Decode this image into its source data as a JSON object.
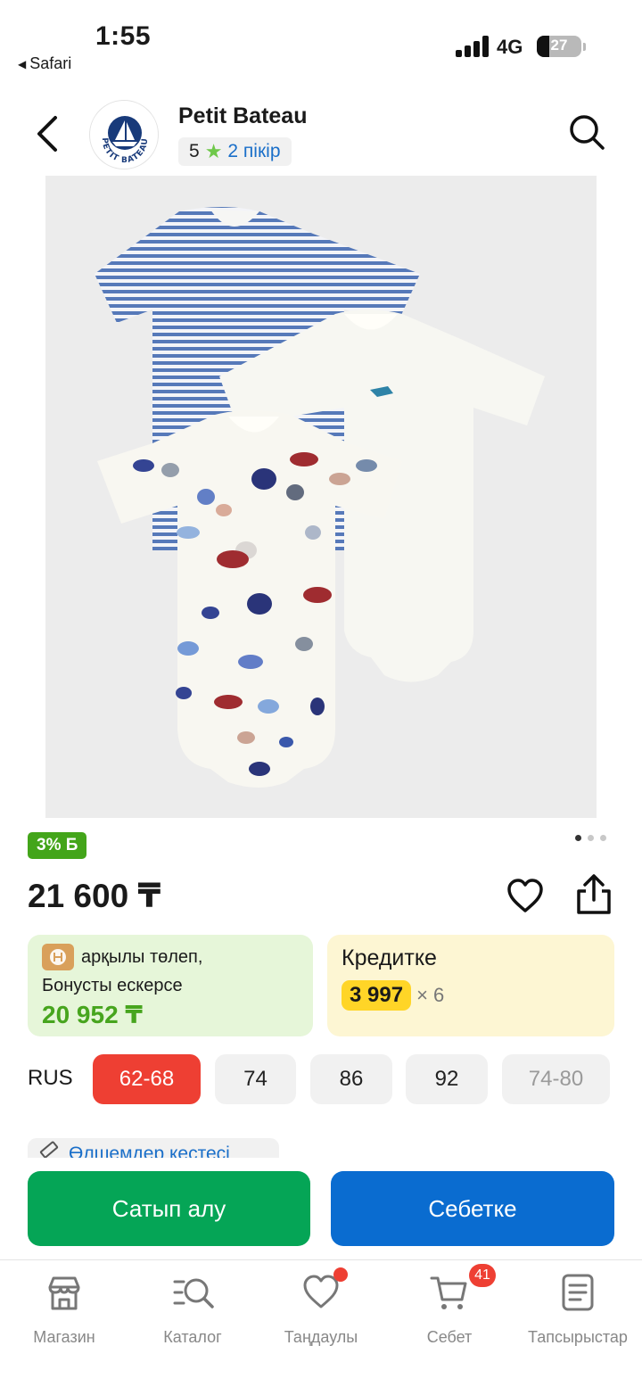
{
  "status_bar": {
    "time": "1:55",
    "back_app": "Safari",
    "network": "4G",
    "battery": "27",
    "battery_level": 0.27
  },
  "header": {
    "store_name": "Petit Bateau",
    "rating_score": "5",
    "reviews": "2 пікір",
    "logo_text": "PETIT BATEAU"
  },
  "product": {
    "discount_badge": "3% Б",
    "image_pagination": {
      "count": 3,
      "active": 1
    },
    "price": "21 600 ₸",
    "pay_card": {
      "line1": "арқылы төлеп,",
      "line2": "Бонусты ескерсе",
      "price": "20 952 ₸"
    },
    "credit_card": {
      "title": "Кредитке",
      "amount": "3 997",
      "times": "× 6"
    },
    "size_system": "RUS",
    "sizes": [
      {
        "label": "62-68",
        "state": "selected"
      },
      {
        "label": "74",
        "state": "available"
      },
      {
        "label": "86",
        "state": "available"
      },
      {
        "label": "92",
        "state": "available"
      },
      {
        "label": "74-80",
        "state": "unavailable"
      }
    ],
    "size_table_link": "Өлшемдер кестесі"
  },
  "actions": {
    "buy_now": "Сатып алу",
    "add_to_cart": "Себетке"
  },
  "tabbar": {
    "items": [
      {
        "label": "Магазин",
        "icon": "store-icon"
      },
      {
        "label": "Каталог",
        "icon": "catalog-search-icon"
      },
      {
        "label": "Таңдаулы",
        "icon": "heart-icon"
      },
      {
        "label": "Себет",
        "icon": "cart-icon",
        "badge": "41"
      },
      {
        "label": "Тапсырыстар",
        "icon": "orders-icon"
      }
    ]
  },
  "colors": {
    "discount_green": "#43a51a",
    "selected_size_red": "#ee3f33",
    "buy_green": "#05a556",
    "cart_blue": "#0a6cd0",
    "credit_yellow": "#ffd527"
  }
}
